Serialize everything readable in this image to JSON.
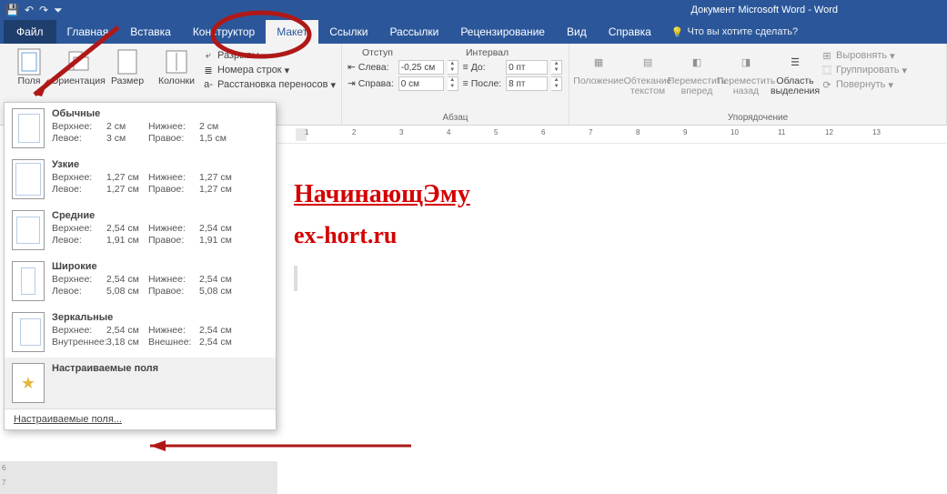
{
  "title": "Документ Microsoft Word  -  Word",
  "qat": {
    "save": "💾",
    "undo": "↶",
    "redo": "↷",
    "custom": "⏷"
  },
  "tabs": {
    "file": "Файл",
    "home": "Главная",
    "insert": "Вставка",
    "design": "Конструктор",
    "layout": "Макет",
    "references": "Ссылки",
    "mailings": "Рассылки",
    "review": "Рецензирование",
    "view": "Вид",
    "help": "Справка",
    "tellme": "Что вы хотите сделать?"
  },
  "pageSetup": {
    "margins": "Поля",
    "orientation": "Ориентация",
    "size": "Размер",
    "columns": "Колонки",
    "breaks": "Разрывы",
    "lineNumbers": "Номера строк",
    "hyphenation": "Расстановка переносов"
  },
  "paragraph": {
    "indentHead": "Отступ",
    "spacingHead": "Интервал",
    "left": "Слева:",
    "right": "Справа:",
    "before": "До:",
    "after": "После:",
    "leftVal": "-0,25 см",
    "rightVal": "0 см",
    "beforeVal": "0 пт",
    "afterVal": "8 пт",
    "group": "Абзац"
  },
  "arrange": {
    "position": "Положение",
    "wrap": "Обтекание текстом",
    "forward": "Переместить вперед",
    "backward": "Переместить назад",
    "selection": "Область выделения",
    "align": "Выровнять",
    "group2": "Группировать",
    "rotate": "Повернуть",
    "group": "Упорядочение"
  },
  "marginsMenu": {
    "presets": [
      {
        "name": "Обычные",
        "tl": "Верхнее:",
        "tv": "2 см",
        "bl": "Нижнее:",
        "bv": "2 см",
        "ll": "Левое:",
        "lv": "3 см",
        "rl": "Правое:",
        "rv": "1,5 см",
        "cls": "p-normal"
      },
      {
        "name": "Узкие",
        "tl": "Верхнее:",
        "tv": "1,27 см",
        "bl": "Нижнее:",
        "bv": "1,27 см",
        "ll": "Левое:",
        "lv": "1,27 см",
        "rl": "Правое:",
        "rv": "1,27 см",
        "cls": "p-narrow"
      },
      {
        "name": "Средние",
        "tl": "Верхнее:",
        "tv": "2,54 см",
        "bl": "Нижнее:",
        "bv": "2,54 см",
        "ll": "Левое:",
        "lv": "1,91 см",
        "rl": "Правое:",
        "rv": "1,91 см",
        "cls": "p-moderate"
      },
      {
        "name": "Широкие",
        "tl": "Верхнее:",
        "tv": "2,54 см",
        "bl": "Нижнее:",
        "bv": "2,54 см",
        "ll": "Левое:",
        "lv": "5,08 см",
        "rl": "Правое:",
        "rv": "5,08 см",
        "cls": "p-wide"
      },
      {
        "name": "Зеркальные",
        "tl": "Верхнее:",
        "tv": "2,54 см",
        "bl": "Нижнее:",
        "bv": "2,54 см",
        "ll": "Внутреннее:",
        "lv": "3,18 см",
        "rl": "Внешнее:",
        "rv": "2,54 см",
        "cls": "p-mirror"
      }
    ],
    "custom": "Настраиваемые поля",
    "customFooter": "Настраиваемые поля..."
  },
  "doc": {
    "heading": "НачинающЭму",
    "sub": "ex-hort.ru"
  },
  "rulerNums": [
    "1",
    "2",
    "3",
    "4",
    "5",
    "6",
    "7",
    "8",
    "9",
    "10",
    "11",
    "12",
    "13"
  ]
}
